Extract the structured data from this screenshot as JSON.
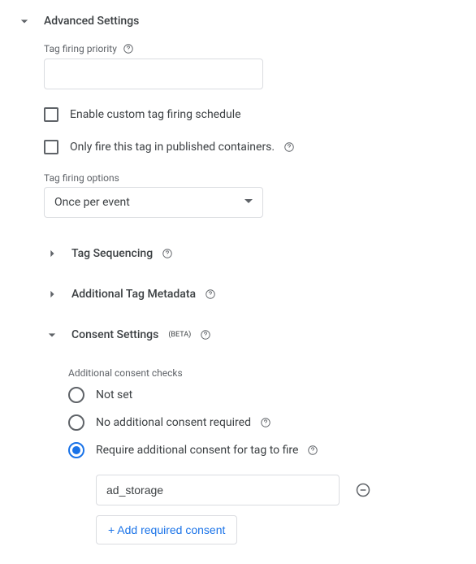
{
  "section": {
    "title": "Advanced Settings"
  },
  "priority": {
    "label": "Tag firing priority",
    "value": ""
  },
  "checkboxes": {
    "custom_schedule": "Enable custom tag firing schedule",
    "only_published": "Only fire this tag in published containers."
  },
  "firing_options": {
    "label": "Tag firing options",
    "value": "Once per event"
  },
  "subsections": {
    "sequencing": "Tag Sequencing",
    "metadata": "Additional Tag Metadata",
    "consent": "Consent Settings",
    "consent_beta": "(BETA)"
  },
  "consent": {
    "label": "Additional consent checks",
    "options": {
      "not_set": "Not set",
      "no_additional": "No additional consent required",
      "require": "Require additional consent for tag to fire"
    },
    "required_value": "ad_storage",
    "add_button": "+ Add required consent"
  }
}
